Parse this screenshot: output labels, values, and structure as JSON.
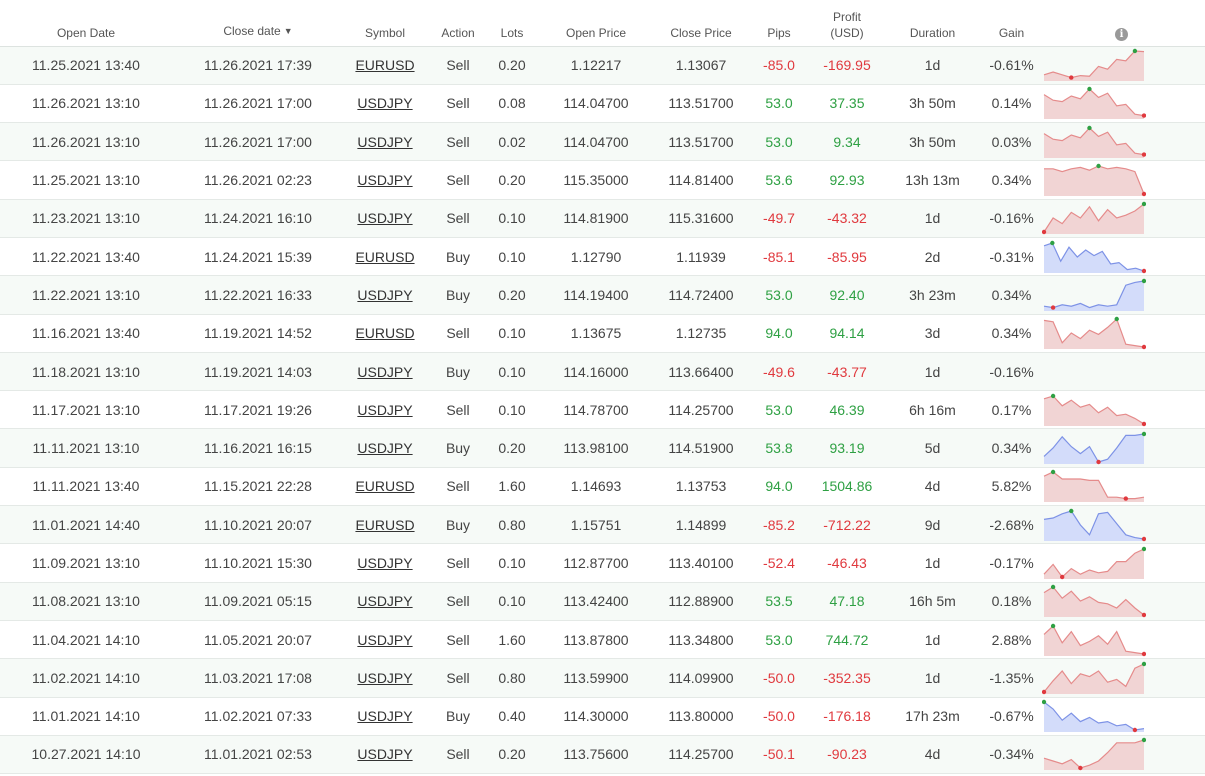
{
  "headers": {
    "open_date": "Open Date",
    "close_date": "Close date",
    "sort_arrow": "▼",
    "symbol": "Symbol",
    "action": "Action",
    "lots": "Lots",
    "open_price": "Open Price",
    "close_price": "Close Price",
    "pips": "Pips",
    "profit_line1": "Profit",
    "profit_line2": "(USD)",
    "duration": "Duration",
    "gain": "Gain",
    "info_icon": "i"
  },
  "colors": {
    "positive": "#2ea043",
    "negative": "#e0393e",
    "sell_fill": "#f1d4d4",
    "sell_line": "#e58b8b",
    "buy_fill": "#d3dcfa",
    "buy_line": "#7d92e6"
  },
  "rows": [
    {
      "open_date": "11.25.2021 13:40",
      "close_date": "11.26.2021 17:39",
      "symbol": "EURUSD",
      "action": "Sell",
      "lots": "0.20",
      "open_price": "1.12217",
      "close_price": "1.13067",
      "pips": "-85.0",
      "profit": "-169.95",
      "duration": "1d",
      "gain": "-0.61%",
      "spark": [
        0.15,
        0.25,
        0.15,
        0.05,
        0.12,
        0.1,
        0.45,
        0.35,
        0.7,
        0.65,
        1.0,
        0.98
      ]
    },
    {
      "open_date": "11.26.2021 13:10",
      "close_date": "11.26.2021 17:00",
      "symbol": "USDJPY",
      "action": "Sell",
      "lots": "0.08",
      "open_price": "114.04700",
      "close_price": "113.51700",
      "pips": "53.0",
      "profit": "37.35",
      "duration": "3h 50m",
      "gain": "0.14%",
      "spark": [
        0.8,
        0.6,
        0.55,
        0.75,
        0.65,
        1.0,
        0.7,
        0.85,
        0.4,
        0.45,
        0.1,
        0.05
      ]
    },
    {
      "open_date": "11.26.2021 13:10",
      "close_date": "11.26.2021 17:00",
      "symbol": "USDJPY",
      "action": "Sell",
      "lots": "0.02",
      "open_price": "114.04700",
      "close_price": "113.51700",
      "pips": "53.0",
      "profit": "9.34",
      "duration": "3h 50m",
      "gain": "0.03%",
      "spark": [
        0.8,
        0.6,
        0.55,
        0.75,
        0.65,
        1.0,
        0.7,
        0.85,
        0.4,
        0.45,
        0.1,
        0.05
      ]
    },
    {
      "open_date": "11.25.2021 13:10",
      "close_date": "11.26.2021 02:23",
      "symbol": "USDJPY",
      "action": "Sell",
      "lots": "0.20",
      "open_price": "115.35000",
      "close_price": "114.81400",
      "pips": "53.6",
      "profit": "92.93",
      "duration": "13h 13m",
      "gain": "0.34%",
      "spark": [
        0.9,
        0.9,
        0.8,
        0.9,
        0.95,
        0.85,
        1.0,
        0.9,
        0.95,
        0.9,
        0.8,
        0.0
      ]
    },
    {
      "open_date": "11.23.2021 13:10",
      "close_date": "11.24.2021 16:10",
      "symbol": "USDJPY",
      "action": "Sell",
      "lots": "0.10",
      "open_price": "114.81900",
      "close_price": "115.31600",
      "pips": "-49.7",
      "profit": "-43.32",
      "duration": "1d",
      "gain": "-0.16%",
      "spark": [
        0.0,
        0.5,
        0.3,
        0.7,
        0.5,
        0.9,
        0.4,
        0.8,
        0.5,
        0.6,
        0.75,
        1.0
      ]
    },
    {
      "open_date": "11.22.2021 13:40",
      "close_date": "11.24.2021 15:39",
      "symbol": "EURUSD",
      "action": "Buy",
      "lots": "0.10",
      "open_price": "1.12790",
      "close_price": "1.11939",
      "pips": "-85.1",
      "profit": "-85.95",
      "duration": "2d",
      "gain": "-0.31%",
      "spark": [
        0.9,
        1.0,
        0.35,
        0.85,
        0.5,
        0.75,
        0.55,
        0.7,
        0.25,
        0.3,
        0.05,
        0.1,
        0.0
      ]
    },
    {
      "open_date": "11.22.2021 13:10",
      "close_date": "11.22.2021 16:33",
      "symbol": "USDJPY",
      "action": "Buy",
      "lots": "0.20",
      "open_price": "114.19400",
      "close_price": "114.72400",
      "pips": "53.0",
      "profit": "92.40",
      "duration": "3h 23m",
      "gain": "0.34%",
      "spark": [
        0.1,
        0.05,
        0.15,
        0.1,
        0.2,
        0.05,
        0.15,
        0.1,
        0.15,
        0.85,
        0.95,
        1.0
      ]
    },
    {
      "open_date": "11.16.2021 13:40",
      "close_date": "11.19.2021 14:52",
      "symbol": "EURUSD",
      "action": "Sell",
      "lots": "0.10",
      "open_price": "1.13675",
      "close_price": "1.12735",
      "pips": "94.0",
      "profit": "94.14",
      "duration": "3d",
      "gain": "0.34%",
      "spark": [
        0.95,
        0.9,
        0.15,
        0.5,
        0.3,
        0.6,
        0.45,
        0.7,
        1.0,
        0.1,
        0.05,
        0.0
      ]
    },
    {
      "open_date": "11.18.2021 13:10",
      "close_date": "11.19.2021 14:03",
      "symbol": "USDJPY",
      "action": "Buy",
      "lots": "0.10",
      "open_price": "114.16000",
      "close_price": "113.66400",
      "pips": "-49.6",
      "profit": "-43.77",
      "duration": "1d",
      "gain": "-0.16%",
      "spark": []
    },
    {
      "open_date": "11.17.2021 13:10",
      "close_date": "11.17.2021 19:26",
      "symbol": "USDJPY",
      "action": "Sell",
      "lots": "0.10",
      "open_price": "114.78700",
      "close_price": "114.25700",
      "pips": "53.0",
      "profit": "46.39",
      "duration": "6h 16m",
      "gain": "0.17%",
      "spark": [
        0.9,
        1.0,
        0.65,
        0.85,
        0.6,
        0.7,
        0.4,
        0.6,
        0.3,
        0.35,
        0.2,
        0.0
      ]
    },
    {
      "open_date": "11.11.2021 13:10",
      "close_date": "11.16.2021 16:15",
      "symbol": "USDJPY",
      "action": "Buy",
      "lots": "0.20",
      "open_price": "113.98100",
      "close_price": "114.51900",
      "pips": "53.8",
      "profit": "93.19",
      "duration": "5d",
      "gain": "0.34%",
      "spark": [
        0.2,
        0.5,
        0.9,
        0.55,
        0.3,
        0.55,
        0.0,
        0.1,
        0.5,
        0.95,
        0.95,
        1.0
      ]
    },
    {
      "open_date": "11.11.2021 13:40",
      "close_date": "11.15.2021 22:28",
      "symbol": "EURUSD",
      "action": "Sell",
      "lots": "1.60",
      "open_price": "1.14693",
      "close_price": "1.13753",
      "pips": "94.0",
      "profit": "1504.86",
      "duration": "4d",
      "gain": "5.82%",
      "spark": [
        0.85,
        1.0,
        0.75,
        0.75,
        0.75,
        0.7,
        0.7,
        0.1,
        0.1,
        0.05,
        0.05,
        0.1
      ]
    },
    {
      "open_date": "11.01.2021 14:40",
      "close_date": "11.10.2021 20:07",
      "symbol": "EURUSD",
      "action": "Buy",
      "lots": "0.80",
      "open_price": "1.15751",
      "close_price": "1.14899",
      "pips": "-85.2",
      "profit": "-712.22",
      "duration": "9d",
      "gain": "-2.68%",
      "spark": [
        0.7,
        0.75,
        0.9,
        1.0,
        0.5,
        0.15,
        0.9,
        0.95,
        0.55,
        0.15,
        0.05,
        0.0
      ]
    },
    {
      "open_date": "11.09.2021 13:10",
      "close_date": "11.10.2021 15:30",
      "symbol": "USDJPY",
      "action": "Sell",
      "lots": "0.10",
      "open_price": "112.87700",
      "close_price": "113.40100",
      "pips": "-52.4",
      "profit": "-46.43",
      "duration": "1d",
      "gain": "-0.17%",
      "spark": [
        0.1,
        0.45,
        0.0,
        0.3,
        0.1,
        0.25,
        0.15,
        0.2,
        0.55,
        0.55,
        0.85,
        1.0
      ]
    },
    {
      "open_date": "11.08.2021 13:10",
      "close_date": "11.09.2021 05:15",
      "symbol": "USDJPY",
      "action": "Sell",
      "lots": "0.10",
      "open_price": "113.42400",
      "close_price": "112.88900",
      "pips": "53.5",
      "profit": "47.18",
      "duration": "16h 5m",
      "gain": "0.18%",
      "spark": [
        0.8,
        1.0,
        0.6,
        0.85,
        0.5,
        0.65,
        0.45,
        0.4,
        0.25,
        0.55,
        0.25,
        0.0
      ]
    },
    {
      "open_date": "11.04.2021 14:10",
      "close_date": "11.05.2021 20:07",
      "symbol": "USDJPY",
      "action": "Sell",
      "lots": "1.60",
      "open_price": "113.87800",
      "close_price": "113.34800",
      "pips": "53.0",
      "profit": "744.72",
      "duration": "1d",
      "gain": "2.88%",
      "spark": [
        0.7,
        1.0,
        0.4,
        0.8,
        0.3,
        0.45,
        0.65,
        0.35,
        0.8,
        0.1,
        0.05,
        0.0
      ]
    },
    {
      "open_date": "11.02.2021 14:10",
      "close_date": "11.03.2021 17:08",
      "symbol": "USDJPY",
      "action": "Sell",
      "lots": "0.80",
      "open_price": "113.59900",
      "close_price": "114.09900",
      "pips": "-50.0",
      "profit": "-352.35",
      "duration": "1d",
      "gain": "-1.35%",
      "spark": [
        0.0,
        0.4,
        0.75,
        0.3,
        0.65,
        0.55,
        0.75,
        0.35,
        0.45,
        0.2,
        0.85,
        1.0
      ]
    },
    {
      "open_date": "11.01.2021 14:10",
      "close_date": "11.02.2021 07:33",
      "symbol": "USDJPY",
      "action": "Buy",
      "lots": "0.40",
      "open_price": "114.30000",
      "close_price": "113.80000",
      "pips": "-50.0",
      "profit": "-176.18",
      "duration": "17h 23m",
      "gain": "-0.67%",
      "spark": [
        1.0,
        0.75,
        0.35,
        0.6,
        0.3,
        0.45,
        0.25,
        0.3,
        0.15,
        0.2,
        0.0,
        0.05
      ]
    },
    {
      "open_date": "10.27.2021 14:10",
      "close_date": "11.01.2021 02:53",
      "symbol": "USDJPY",
      "action": "Sell",
      "lots": "0.20",
      "open_price": "113.75600",
      "close_price": "114.25700",
      "pips": "-50.1",
      "profit": "-90.23",
      "duration": "4d",
      "gain": "-0.34%",
      "spark": [
        0.35,
        0.25,
        0.15,
        0.3,
        0.0,
        0.1,
        0.25,
        0.55,
        0.9,
        0.9,
        0.9,
        1.0
      ]
    }
  ]
}
